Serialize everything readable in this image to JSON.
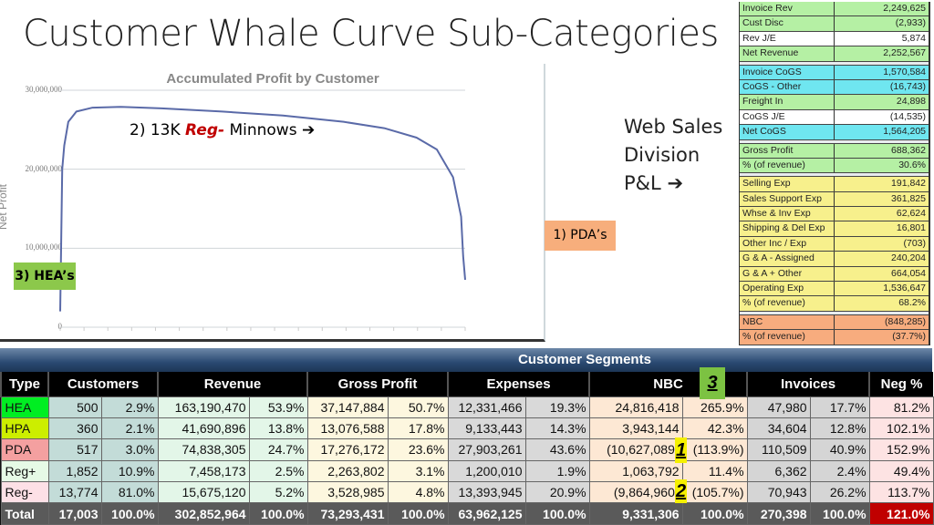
{
  "slide": {
    "title": "Customer Whale Curve Sub-Categories"
  },
  "chart_data": {
    "type": "line",
    "title": "Accumulated Profit by Customer",
    "xlabel": "",
    "ylabel": "Net Profit",
    "ylim": [
      0,
      30000000
    ],
    "yticks": [
      "0",
      "10,000,000",
      "20,000,000",
      "30,000,000"
    ],
    "grid": true,
    "series": [
      {
        "color": "#5a6aa8",
        "x_fraction": [
          0,
          0.005,
          0.01,
          0.02,
          0.04,
          0.08,
          0.15,
          0.25,
          0.4,
          0.55,
          0.7,
          0.8,
          0.88,
          0.93,
          0.97,
          0.99,
          0.995,
          1.0
        ],
        "values": [
          2000000,
          20000000,
          23000000,
          26000000,
          27300000,
          27800000,
          27900000,
          27700000,
          27300000,
          26800000,
          26000000,
          25200000,
          24000000,
          22500000,
          19000000,
          14000000,
          9000000,
          6000000
        ]
      }
    ]
  },
  "annotations": {
    "minnows_prefix": "2) 13K ",
    "minnows_em": "Reg-",
    "minnows_suffix": " Minnows",
    "arrow": "➔",
    "pda": "1) PDA’s",
    "hea": "3) HEA’s",
    "pnl_label_1": "Web Sales",
    "pnl_label_2": "Division",
    "pnl_label_3": "P&L"
  },
  "pnl": {
    "groups": [
      [
        {
          "label": "Invoice Rev",
          "value": "2,249,625",
          "color": "#b5f0a4"
        },
        {
          "label": "Cust Disc",
          "value": "(2,933)",
          "color": "#b5f0a4"
        },
        {
          "label": "Rev J/E",
          "value": "5,874",
          "color": "#ffffff"
        },
        {
          "label": "Net Revenue",
          "value": "2,252,567",
          "color": "#b5f0a4"
        }
      ],
      [
        {
          "label": "Invoice CoGS",
          "value": "1,570,584",
          "color": "#6fe6f0"
        },
        {
          "label": "CoGS - Other",
          "value": "(16,743)",
          "color": "#6fe6f0"
        },
        {
          "label": "Freight In",
          "value": "24,898",
          "color": "#b5f0a4"
        },
        {
          "label": "CoGS J/E",
          "value": "(14,535)",
          "color": "#ffffff"
        },
        {
          "label": "Net CoGS",
          "value": "1,564,205",
          "color": "#6fe6f0"
        }
      ],
      [
        {
          "label": "Gross Profit",
          "value": "688,362",
          "color": "#b5f0a4"
        },
        {
          "label": "% (of revenue)",
          "value": "30.6%",
          "color": "#b5f0a4"
        }
      ],
      [
        {
          "label": "Selling Exp",
          "value": "191,842",
          "color": "#f7f08c"
        },
        {
          "label": "Sales Support Exp",
          "value": "361,825",
          "color": "#f7f08c"
        },
        {
          "label": "Whse & Inv Exp",
          "value": "62,624",
          "color": "#f7f08c"
        },
        {
          "label": "Shipping & Del Exp",
          "value": "16,801",
          "color": "#f7f08c"
        },
        {
          "label": "Other Inc / Exp",
          "value": "(703)",
          "color": "#f7f08c"
        },
        {
          "label": "G & A - Assigned",
          "value": "240,204",
          "color": "#f7f08c"
        },
        {
          "label": "G & A + Other",
          "value": "664,054",
          "color": "#f7f08c"
        },
        {
          "label": "Operating Exp",
          "value": "1,536,647",
          "color": "#f7f08c"
        },
        {
          "label": "% (of revenue)",
          "value": "68.2%",
          "color": "#f7f08c"
        }
      ],
      [
        {
          "label": "NBC",
          "value": "(848,285)",
          "color": "#f7ac7e"
        },
        {
          "label": "% (of revenue)",
          "value": "(37.7%)",
          "color": "#f7ac7e"
        }
      ]
    ]
  },
  "segments": {
    "title": "Customer Segments",
    "headers": [
      "Type",
      "Customers",
      "Revenue",
      "Gross Profit",
      "Expenses",
      "NBC",
      "Invoices",
      "Neg %"
    ],
    "rows": [
      {
        "type": "HEA",
        "type_color": "#00ee22",
        "cells": [
          "500",
          "2.9%",
          "163,190,470",
          "53.9%",
          "37,147,884",
          "50.7%",
          "12,331,466",
          "19.3%",
          "24,816,418",
          "265.9%",
          "47,980",
          "17.7%",
          "81.2%"
        ]
      },
      {
        "type": "HPA",
        "type_color": "#ccee00",
        "cells": [
          "360",
          "2.1%",
          "41,690,896",
          "13.8%",
          "13,076,588",
          "17.8%",
          "9,133,443",
          "14.3%",
          "3,943,144",
          "42.3%",
          "34,604",
          "12.8%",
          "102.1%"
        ]
      },
      {
        "type": "PDA",
        "type_color": "#f4a0a0",
        "cells": [
          "517",
          "3.0%",
          "74,838,305",
          "24.7%",
          "17,276,172",
          "23.6%",
          "27,903,261",
          "43.6%",
          "(10,627,089)",
          "(113.9%)",
          "110,509",
          "40.9%",
          "152.9%"
        ]
      },
      {
        "type": "Reg+",
        "type_color": "#e6fae6",
        "cells": [
          "1,852",
          "10.9%",
          "7,458,173",
          "2.5%",
          "2,263,802",
          "3.1%",
          "1,200,010",
          "1.9%",
          "1,063,792",
          "11.4%",
          "6,362",
          "2.4%",
          "49.4%"
        ]
      },
      {
        "type": "Reg-",
        "type_color": "#fde0e6",
        "cells": [
          "13,774",
          "81.0%",
          "15,675,120",
          "5.2%",
          "3,528,985",
          "4.8%",
          "13,393,945",
          "20.9%",
          "(9,864,960)",
          "(105.7%)",
          "70,943",
          "26.2%",
          "113.7%"
        ]
      }
    ],
    "total": {
      "type": "Total",
      "cells": [
        "17,003",
        "100.0%",
        "302,852,964",
        "100.0%",
        "73,293,431",
        "100.0%",
        "63,962,125",
        "100.0%",
        "9,331,306",
        "100.0%",
        "270,398",
        "100.0%",
        "121.0%"
      ]
    },
    "badges": [
      "1",
      "2",
      "3"
    ]
  }
}
